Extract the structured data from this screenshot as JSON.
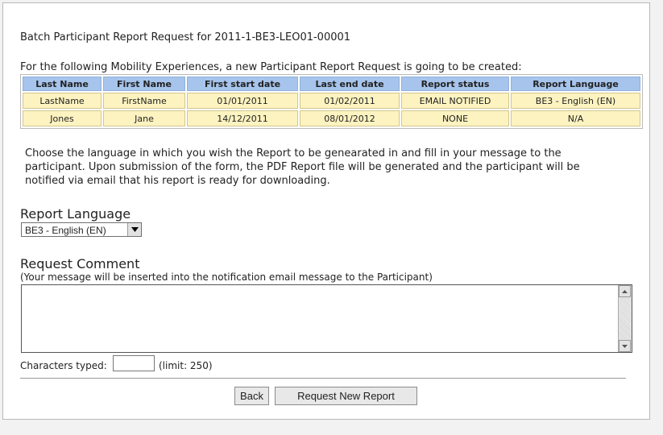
{
  "title": "Batch Participant Report Request for 2011-1-BE3-LEO01-00001",
  "intro": "For the following Mobility Experiences, a new Participant Report Request is going to be created:",
  "table": {
    "headers": [
      "Last Name",
      "First Name",
      "First start date",
      "Last end date",
      "Report status",
      "Report Language"
    ],
    "rows": [
      [
        "LastName",
        "FirstName",
        "01/01/2011",
        "01/02/2011",
        "EMAIL NOTIFIED",
        "BE3 - English (EN)"
      ],
      [
        "Jones",
        "Jane",
        "14/12/2011",
        "08/01/2012",
        "NONE",
        "N/A"
      ]
    ]
  },
  "instructions": "Choose the language in which you wish the Report to be genearated in and fill in your message to the participant. Upon submission of the form, the PDF Report file will be generated and the participant will be notified via email that his report is ready for downloading.",
  "report_language": {
    "label": "Report Language",
    "selected": "BE3 - English (EN)",
    "icon": "chevron-down-icon"
  },
  "comment": {
    "label": "Request Comment",
    "hint": "(Your message will be inserted into the notification email message to the Participant)",
    "value": ""
  },
  "chars": {
    "label": "Characters typed:",
    "value": "",
    "limit": "(limit: 250)"
  },
  "buttons": {
    "back": "Back",
    "request": "Request New Report"
  }
}
